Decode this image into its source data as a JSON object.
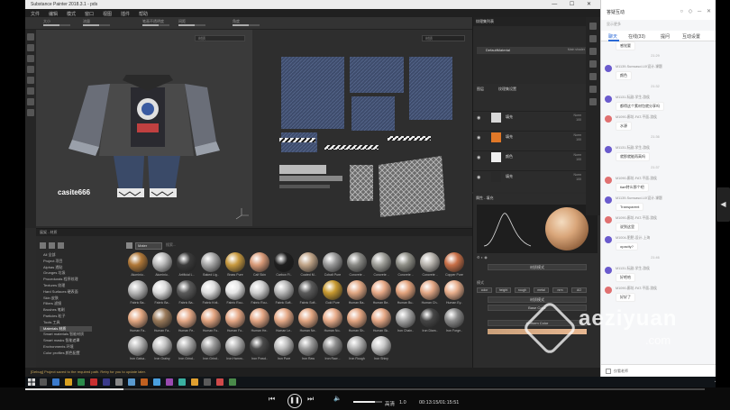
{
  "app": {
    "title": "Substance Painter 2018.3.1 - pds",
    "menu": [
      "文件",
      "编辑",
      "模式",
      "窗口",
      "视图",
      "插件",
      "帮助"
    ],
    "tool_options": [
      "大小",
      "流量",
      "笔画不透明度",
      "间距",
      "角度"
    ],
    "viewport3d_dropdown": "材质",
    "viewport2d_dropdown": "材质",
    "viewport_user_watermark": "casite666",
    "status_text": "[Debug] Project saved to the required path. Retry for you to update later."
  },
  "texture_set": {
    "panel_title": "纹理集列表",
    "item_label": "DefaultMaterial",
    "shader_label": "Main shader"
  },
  "layers": {
    "tabs": [
      "图层",
      "纹理集设置"
    ],
    "rows": [
      {
        "name": "填充",
        "blend": "Norm",
        "opacity": "100",
        "thumb": "#d8d8d8"
      },
      {
        "name": "填充",
        "blend": "Norm",
        "opacity": "100",
        "thumb": "#e07828"
      },
      {
        "name": "颜色",
        "blend": "Norm",
        "opacity": "100",
        "thumb": "#f0f0f0"
      },
      {
        "name": "填充",
        "blend": "Norm",
        "opacity": "100",
        "thumb": "#2a2a2a"
      }
    ]
  },
  "properties": {
    "title": "属性 - 填充",
    "material_button": "材质模式",
    "mode_label": "模式",
    "channels": [
      "color",
      "height",
      "rough",
      "metal",
      "nrm",
      "AO"
    ],
    "source_label": "Base Color",
    "button_a": "材质模式",
    "button_b": "Base Color",
    "button_c": "Uniform Color"
  },
  "shelf": {
    "title": "展架 - 材质",
    "filter_chip": "Mater",
    "search_placeholder": "搜索...",
    "categories": [
      "All 全部",
      "Project 项目",
      "Alphas 透贴",
      "Grunges 垃圾",
      "Procedurals 程序纹理",
      "Textures 纹理",
      "Hard Surfaces 硬表面",
      "Skin 皮肤",
      "Filters 滤镜",
      "Brushes 笔刷",
      "Particles 粒子",
      "Tools 工具",
      "Materials 材质",
      "Smart materials 智能材质",
      "Smart masks 智能遮罩",
      "Environments 环境",
      "Color profiles 颜色配置"
    ],
    "active_category": 12,
    "materials": [
      {
        "label": "Aluminiu..",
        "color": "#b07838"
      },
      {
        "label": "Aluminiu..",
        "color": "#bcbcbc"
      },
      {
        "label": "Artificial L..",
        "color": "#3a3a3a"
      },
      {
        "label": "Baked Lig..",
        "color": "#a8a8a8"
      },
      {
        "label": "Brass Pure",
        "color": "#c89a40"
      },
      {
        "label": "Calf Skin",
        "color": "#d89a78"
      },
      {
        "label": "Carbon Fi..",
        "color": "#1e1e1e"
      },
      {
        "label": "Coated M..",
        "color": "#c0a488"
      },
      {
        "label": "Cobalt Pure",
        "color": "#9a9a9a"
      },
      {
        "label": "Concrete ..",
        "color": "#8a8a86"
      },
      {
        "label": "Concrete ..",
        "color": "#a0a09a"
      },
      {
        "label": "Concrete ..",
        "color": "#909088"
      },
      {
        "label": "Concrete ..",
        "color": "#b8b4ae"
      },
      {
        "label": "Copper Pure",
        "color": "#c87048"
      },
      {
        "label": "Fabric Ba..",
        "color": "#b8b8b8"
      },
      {
        "label": "Fabric Ba..",
        "color": "#dcdcdc"
      },
      {
        "label": "Fabric Ba..",
        "color": "#5a5a5a"
      },
      {
        "label": "Fabric Knit..",
        "color": "#dedede"
      },
      {
        "label": "Fabric Rou..",
        "color": "#e6e6e6"
      },
      {
        "label": "Fabric Rou..",
        "color": "#d0d0d0"
      },
      {
        "label": "Fabric Soft..",
        "color": "#b8b8b8"
      },
      {
        "label": "Fabric Soft..",
        "color": "#5a5a5a"
      },
      {
        "label": "Gold Pure",
        "color": "#c89a30"
      },
      {
        "label": "Human Ba..",
        "color": "#e2a884"
      },
      {
        "label": "Human Be..",
        "color": "#e8aa88"
      },
      {
        "label": "Human Bu..",
        "color": "#e4a47e"
      },
      {
        "label": "Human Ch..",
        "color": "#e4a886"
      },
      {
        "label": "Human Ey..",
        "color": "#e8ae8c"
      },
      {
        "label": "Human Fa..",
        "color": "#e4a882"
      },
      {
        "label": "Human Fa..",
        "color": "#9a7a5a"
      },
      {
        "label": "Human Fe..",
        "color": "#e6aa88"
      },
      {
        "label": "Human Fo..",
        "color": "#e2a480"
      },
      {
        "label": "Human Fo..",
        "color": "#e6a886"
      },
      {
        "label": "Human He..",
        "color": "#e4a684"
      },
      {
        "label": "Human Le..",
        "color": "#e6aa88"
      },
      {
        "label": "Human Ne..",
        "color": "#e2a682"
      },
      {
        "label": "Human No..",
        "color": "#e8ac8a"
      },
      {
        "label": "Human Sh..",
        "color": "#e4a682"
      },
      {
        "label": "Human Sk..",
        "color": "#e6a886"
      },
      {
        "label": "Iron Chain..",
        "color": "#a6a6a6"
      },
      {
        "label": "Iron Diam..",
        "color": "#464646"
      },
      {
        "label": "Iron Forge..",
        "color": "#8a8a8a"
      },
      {
        "label": "Iron Galva..",
        "color": "#b4b4b4"
      },
      {
        "label": "Iron Grainy",
        "color": "#c2c2c2"
      },
      {
        "label": "Iron Grind..",
        "color": "#aaaaaa"
      },
      {
        "label": "Iron Grind..",
        "color": "#9a9a9a"
      },
      {
        "label": "Iron Hamm..",
        "color": "#b0b0b0"
      },
      {
        "label": "Iron Powd..",
        "color": "#4a4a4a"
      },
      {
        "label": "Iron Pure",
        "color": "#bcbcbc"
      },
      {
        "label": "Iron Raw",
        "color": "#9c9c9c"
      },
      {
        "label": "Iron Raw ..",
        "color": "#8c8c8c"
      },
      {
        "label": "Iron Rough",
        "color": "#b2b2b2"
      },
      {
        "label": "Iron Shiny",
        "color": "#c8c8c8"
      }
    ]
  },
  "player": {
    "quality_label": "高清",
    "speed_label": "1.0",
    "time": "00:13:15/01:15:51",
    "progress": 0.145,
    "volume": 0.75
  },
  "chat": {
    "header_title": "答疑互动",
    "header_sub": "显示更多",
    "tabs": [
      "聊天",
      "在线(33)",
      "提问",
      "互动设置"
    ],
    "active_tab": 0,
    "footer": "仅看老师",
    "messages": [
      {
        "type": "bubble",
        "text": "感觉要"
      },
      {
        "type": "time",
        "text": "21:29"
      },
      {
        "type": "msg",
        "name": "M1139-Sunwasci-UX设计-课题",
        "text": "颜色",
        "avatar": "#6a5acd"
      },
      {
        "type": "time",
        "text": "21:32"
      },
      {
        "type": "msg",
        "name": "M1131-阮副-学生-游侯",
        "text": "都得这个素材包就分享吗",
        "avatar": "#6a5acd"
      },
      {
        "type": "msg",
        "name": "M1090-廊坊-FAT-平面-游侯",
        "text": "水源",
        "avatar": "#e07070"
      },
      {
        "type": "time",
        "text": "21:36"
      },
      {
        "type": "msg",
        "name": "M1131-阮副-学生-游侯",
        "text": "就那就能再高吗",
        "avatar": "#6a5acd"
      },
      {
        "type": "time",
        "text": "21:37"
      },
      {
        "type": "msg",
        "name": "M1090-廊坊-FAT-平面-游侯",
        "text": "tiart特么那个吧",
        "avatar": "#e07070"
      },
      {
        "type": "msg",
        "name": "M1139-Sunwasci-UX设计-课题",
        "text": "Transparent",
        "avatar": "#6a5acd"
      },
      {
        "type": "msg",
        "name": "M1090-廊坊-FAT-平面-游侯",
        "text": "说到这里",
        "avatar": "#e07070"
      },
      {
        "type": "msg",
        "name": "M1004-肥肥-设计-上海",
        "text": "opacity?",
        "avatar": "#6a5acd"
      },
      {
        "type": "time",
        "text": "21:46"
      },
      {
        "type": "msg",
        "name": "M1131-阮副-学生-游侯",
        "text": "好吧哈",
        "avatar": "#6a5acd"
      },
      {
        "type": "msg",
        "name": "M1090-廊坊-FAT-平面-游侯",
        "text": "好好了",
        "avatar": "#e07070"
      }
    ]
  },
  "watermark": {
    "name": "aeziyuan",
    "domain": ".com"
  }
}
